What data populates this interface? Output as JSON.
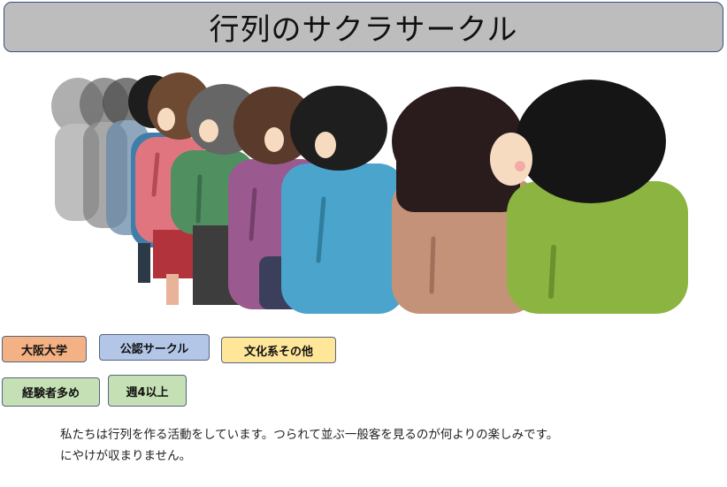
{
  "header": {
    "title": "行列のサクラサークル"
  },
  "illustration": {
    "subject": "people standing in a queue viewed from behind",
    "colors": {
      "hair_dark": "#1c1c1c",
      "shirt_green": "#8bb440",
      "shirt_tan": "#c49279",
      "shirt_blue": "#4aa4cc",
      "shirt_purple": "#9a5a90",
      "shirt_teal": "#4f8f60",
      "shirt_pink": "#e0757f",
      "skin": "#f7dbc0"
    }
  },
  "tags": [
    {
      "label": "大阪大学",
      "color": "#f4b183"
    },
    {
      "label": "公認サークル",
      "color": "#b4c6e7"
    },
    {
      "label": "文化系その他",
      "color": "#ffe699"
    },
    {
      "label": "経験者多め",
      "color": "#c5e0b4"
    },
    {
      "label": "週4以上",
      "color": "#c5e0b4"
    }
  ],
  "description": {
    "line1": "私たちは行列を作る活動をしています。つられて並ぶ一般客を見るのが何よりの楽しみです。",
    "line2": "にやけが収まりません。"
  }
}
